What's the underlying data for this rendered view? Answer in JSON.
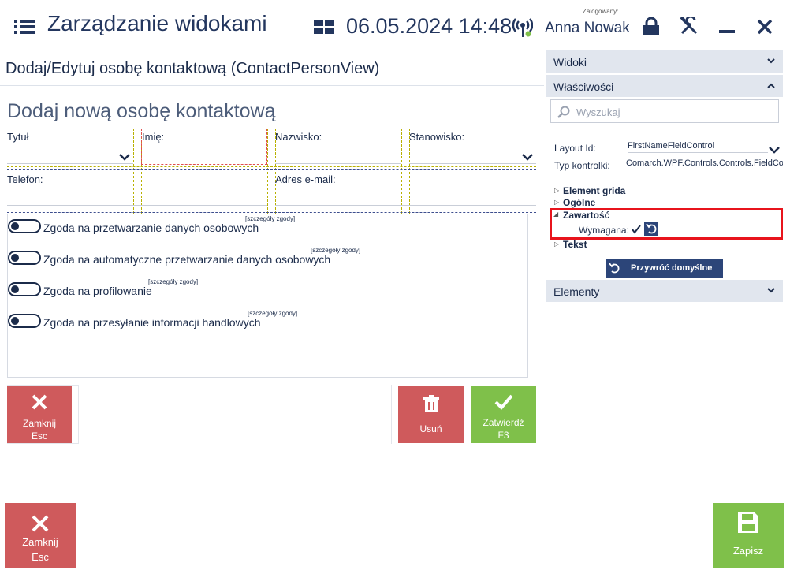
{
  "header": {
    "title": "Zarządzanie widokami",
    "datetime": "06.05.2024 14:48",
    "logged_label": "Zalogowany:",
    "user": "Anna Nowak"
  },
  "view_title": "Dodaj/Edytuj osobę kontaktową (ContactPersonView)",
  "form": {
    "heading": "Dodaj nową osobę kontaktową",
    "fields": {
      "title": "Tytuł",
      "first_name": "Imię:",
      "last_name": "Nazwisko:",
      "position": "Stanowisko:",
      "phone": "Telefon:",
      "email": "Adres e-mail:"
    },
    "consents": [
      {
        "label": "Zgoda na przetwarzanie danych osobowych",
        "details": "[szczegóły zgody]"
      },
      {
        "label": "Zgoda na automatyczne przetwarzanie danych osobowych",
        "details": "[szczegóły zgody]"
      },
      {
        "label": "Zgoda na profilowanie",
        "details": "[szczegóły zgody]"
      },
      {
        "label": "Zgoda na przesyłanie informacji handlowych",
        "details": "[szczegóły zgody]"
      }
    ],
    "buttons": {
      "close_label": "Zamknij",
      "close_shortcut": "Esc",
      "delete_label": "Usuń",
      "confirm_label": "Zatwierdź",
      "confirm_shortcut": "F3"
    }
  },
  "footer": {
    "close_label": "Zamknij",
    "close_shortcut": "Esc",
    "save_label": "Zapisz"
  },
  "right_panel": {
    "views_label": "Widoki",
    "properties_label": "Właściwości",
    "search_placeholder": "Wyszukaj",
    "layout_id_label": "Layout Id:",
    "layout_id_value": "FirstNameFieldControl",
    "control_type_label": "Typ kontrolki:",
    "control_type_value": "Comarch.WPF.Controls.Controls.FieldControl",
    "tree": {
      "grid_element": "Element grida",
      "general": "Ogólne",
      "content": "Zawartość",
      "required_label": "Wymagana:",
      "text": "Tekst"
    },
    "restore_defaults": "Przywróć domyślne",
    "elements_label": "Elementy"
  },
  "colors": {
    "accent_navy": "#23365e",
    "red_tile": "#cf5a5c",
    "green_tile": "#7fc04a",
    "highlight_red": "#e8141c",
    "panel_header": "#e1e6ee"
  }
}
